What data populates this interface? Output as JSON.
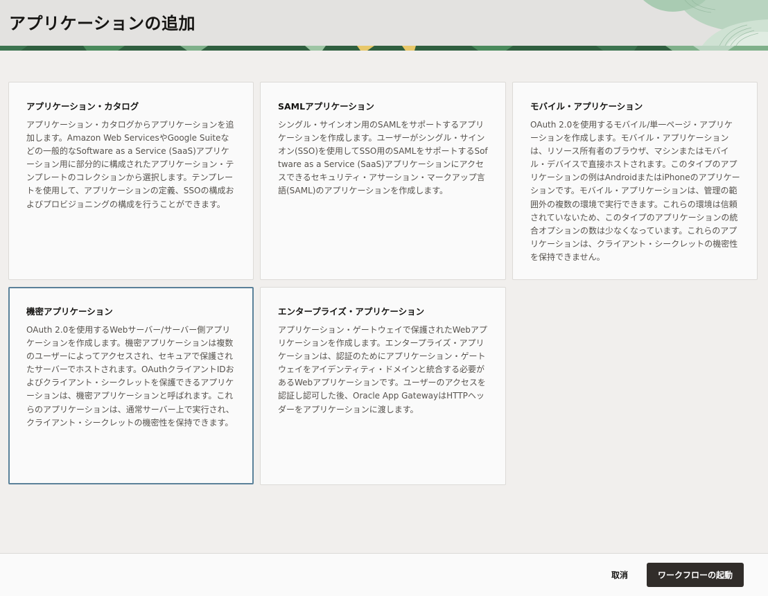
{
  "header": {
    "title": "アプリケーションの追加"
  },
  "cards": [
    {
      "title": "アプリケーション・カタログ",
      "description": "アプリケーション・カタログからアプリケーションを追加します。Amazon Web ServicesやGoogle Suiteなどの一般的なSoftware as a Service (SaaS)アプリケーション用に部分的に構成されたアプリケーション・テンプレートのコレクションから選択します。テンプレートを使用して、アプリケーションの定義、SSOの構成およびプロビジョニングの構成を行うことができます。"
    },
    {
      "title": "SAMLアプリケーション",
      "description": "シングル・サインオン用のSAMLをサポートするアプリケーションを作成します。ユーザーがシングル・サインオン(SSO)を使用してSSO用のSAMLをサポートするSoftware as a Service (SaaS)アプリケーションにアクセスできるセキュリティ・アサーション・マークアップ言語(SAML)のアプリケーションを作成します。"
    },
    {
      "title": "モバイル・アプリケーション",
      "description": "OAuth 2.0を使用するモバイル/単一ページ・アプリケーションを作成します。モバイル・アプリケーションは、リソース所有者のブラウザ、マシンまたはモバイル・デバイスで直接ホストされます。このタイプのアプリケーションの例はAndroidまたはiPhoneのアプリケーションです。モバイル・アプリケーションは、管理の範囲外の複数の環境で実行できます。これらの環境は信頼されていないため、このタイプのアプリケーションの統合オプションの数は少なくなっています。これらのアプリケーションは、クライアント・シークレットの機密性を保持できません。"
    },
    {
      "title": "機密アプリケーション",
      "description": "OAuth 2.0を使用するWebサーバー/サーバー側アプリケーションを作成します。機密アプリケーションは複数のユーザーによってアクセスされ、セキュアで保護されたサーバーでホストされます。OAuthクライアントIDおよびクライアント・シークレットを保護できるアプリケーションは、機密アプリケーションと呼ばれます。これらのアプリケーションは、通常サーバー上で実行され、クライアント・シークレットの機密性を保持できます。"
    },
    {
      "title": "エンタープライズ・アプリケーション",
      "description": "アプリケーション・ゲートウェイで保護されたWebアプリケーションを作成します。エンタープライズ・アプリケーションは、認証のためにアプリケーション・ゲートウェイをアイデンティティ・ドメインと統合する必要があるWebアプリケーションです。ユーザーのアクセスを認証し認可した後、Oracle App GatewayはHTTPヘッダーをアプリケーションに渡します。"
    }
  ],
  "footer": {
    "cancel_label": "取消",
    "start_label": "ワークフローの起動"
  },
  "colors": {
    "header_bg": "#e3e2e0",
    "page_bg": "#f1efed",
    "card_bg": "#fafafa",
    "selected_border": "#5a8199",
    "primary_button": "#312d2a",
    "band_green": "#2f5f3f",
    "band_yellow": "#e8c86a"
  }
}
